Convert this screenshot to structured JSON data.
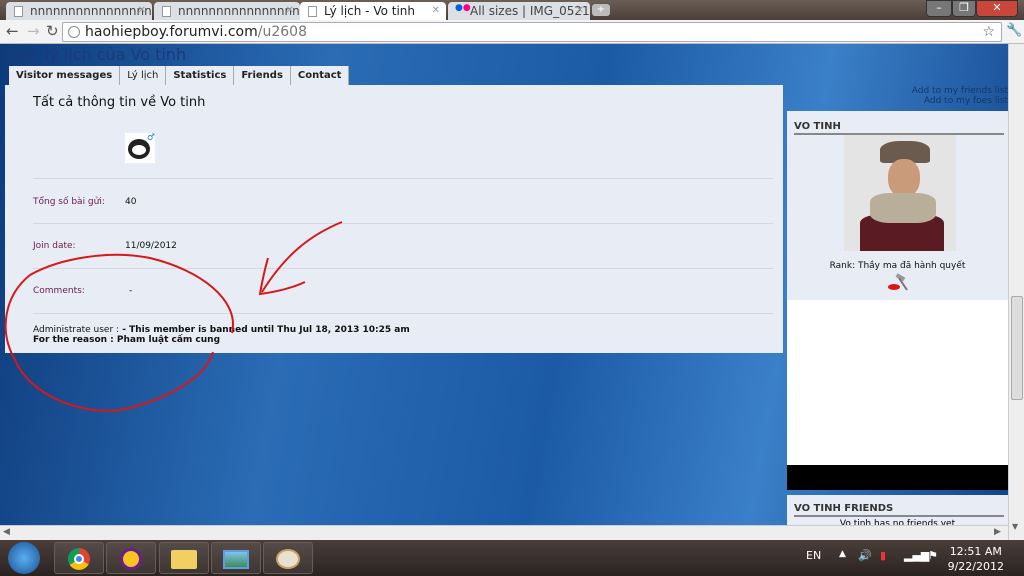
{
  "browser": {
    "tabs": [
      {
        "label": "nnnnnnnnnnnnnnnn...",
        "active": false
      },
      {
        "label": "nnnnnnnnnnnnnnnn...",
        "active": false
      },
      {
        "label": "Lý lịch - Vo tinh",
        "active": true
      },
      {
        "label": "All sizes | IMG_0521...",
        "active": false
      }
    ],
    "new_tab": "+",
    "url_host": "haohiepboy.forumvi.com",
    "url_path": "/u2608",
    "star_icon": "☆",
    "menu_icon": "wrench-icon"
  },
  "page": {
    "title": "Xem lý lịch của Vo tinh",
    "tabs": [
      "Visitor messages",
      "Lý lịch",
      "Statistics",
      "Friends",
      "Contact"
    ],
    "main_title": "Tất cả thông tin về Vo tinh",
    "fields": [
      {
        "label": "Tổng số bài gửi:",
        "value": "40"
      },
      {
        "label": "Join date:",
        "value": "11/09/2012"
      },
      {
        "label": "Comments:",
        "value": "-"
      }
    ],
    "admin_label": "Administrate user :",
    "ban_text": " - This member is banned until Thu Jul 18, 2013 10:25 am",
    "reason_text": "For the reason : Pham luật cấm cung"
  },
  "sidebar": {
    "add_friend": "Add to my friends list",
    "add_foe": "Add to my foes list",
    "username": "VO TINH",
    "rank": "Rank: Thầy ma đã hành quyết",
    "friends_title": "VO TINH FRIENDS",
    "friends_text": "Vo tinh has no friends yet"
  },
  "annotation_color": "#d81818",
  "taskbar": {
    "apps": [
      "chrome",
      "yahoo-messenger",
      "windows-explorer",
      "photo-viewer",
      "paint"
    ],
    "lang": "EN",
    "time": "12:51 AM",
    "date": "9/22/2012"
  }
}
